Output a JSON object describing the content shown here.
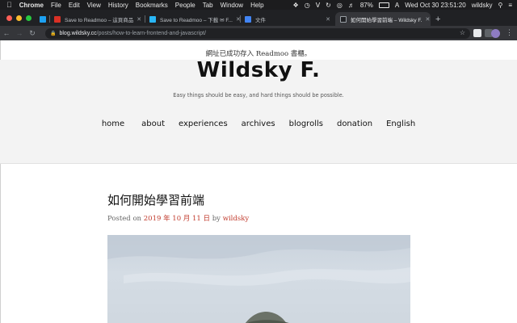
{
  "menubar": {
    "app": "Chrome",
    "items": [
      "File",
      "Edit",
      "View",
      "History",
      "Bookmarks",
      "People",
      "Tab",
      "Window",
      "Help"
    ],
    "battery": "87%",
    "datetime": "Wed Oct 30  23:51:20",
    "user": "wildsky"
  },
  "tabs": [
    {
      "title": "Save to Readmoo – 這頁商品",
      "favicon_color": "#d93025"
    },
    {
      "title": "Save to Readmoo – 下載 ✉ F...",
      "favicon_color": "#29b6f6"
    },
    {
      "title": "文件",
      "favicon_color": "#4285f4"
    },
    {
      "title": "如何開始學習前端 – Wildsky F.",
      "favicon_color": "#202124"
    }
  ],
  "omnibox": {
    "host": "blog.wildsky.cc",
    "path": "/posts/how-to-learn-frontend-and-javascript/"
  },
  "page": {
    "notice": "網址已成功存入 Readmoo 書櫃。",
    "site_title": "Wildsky F.",
    "tagline": "Easy things should be easy, and hard things should be possible.",
    "nav": [
      "home",
      "about",
      "experiences",
      "archives",
      "blogrolls",
      "donation",
      "English"
    ],
    "post_title": "如何開始學習前端",
    "meta_prefix": "Posted on",
    "meta_date": "2019 年 10 月 11 日",
    "meta_by": "by",
    "meta_author": "wildsky"
  },
  "colors": {
    "accent_link": "#c0392b",
    "header_bg": "#f3f3f3"
  }
}
